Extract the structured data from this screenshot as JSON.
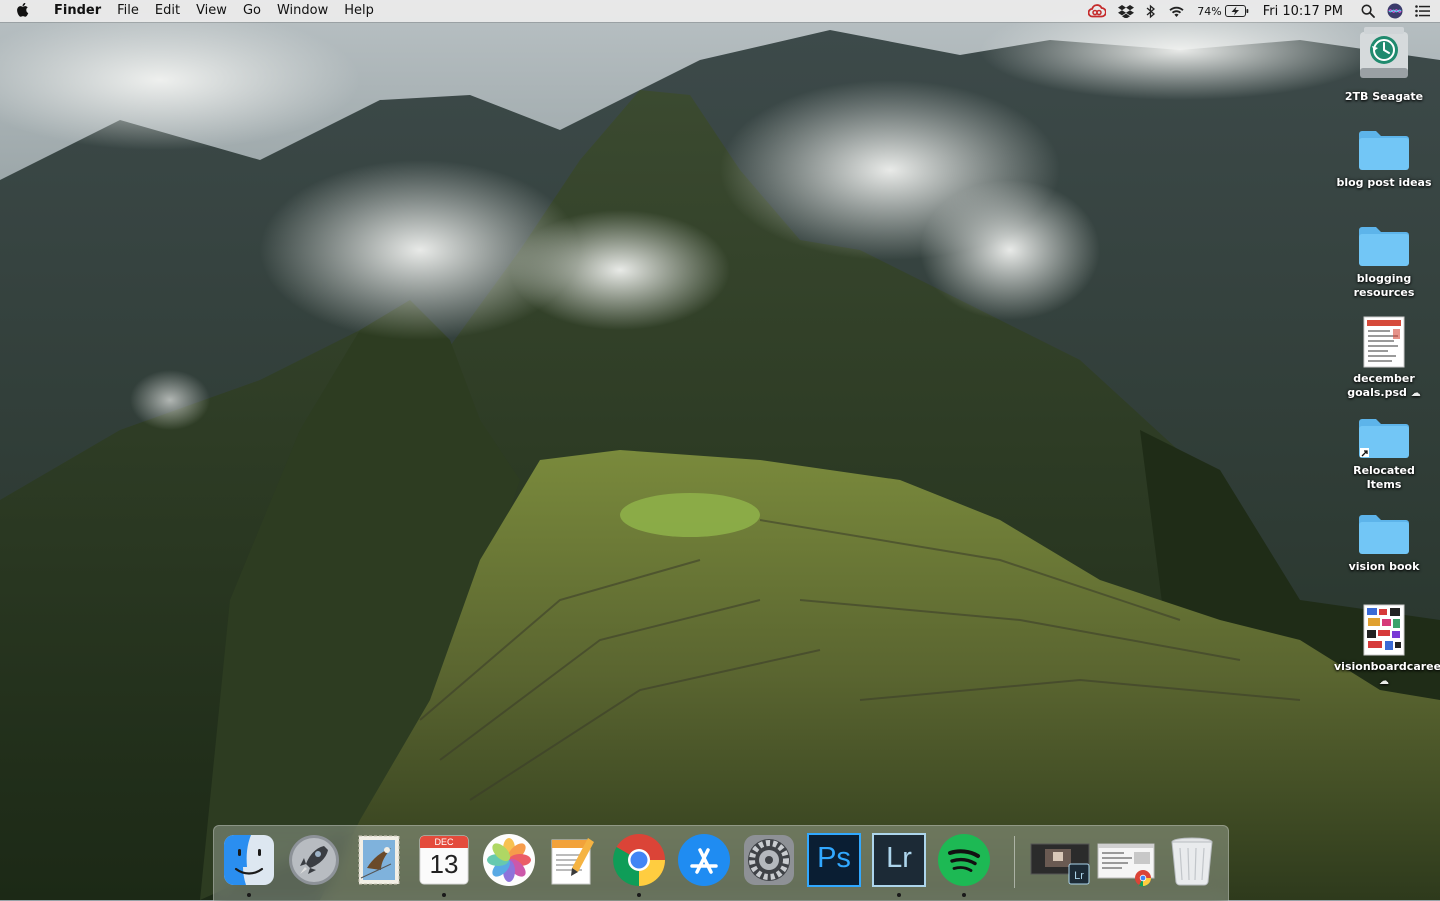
{
  "menubar": {
    "app_name": "Finder",
    "menus": [
      "File",
      "Edit",
      "View",
      "Go",
      "Window",
      "Help"
    ],
    "battery_percent": "74%",
    "clock": "Fri 10:17 PM"
  },
  "desktop": {
    "items": [
      {
        "label": "2TB Seagate",
        "kind": "time-machine-drive"
      },
      {
        "label": "blog post ideas",
        "kind": "folder"
      },
      {
        "label": "blogging resources",
        "kind": "folder"
      },
      {
        "label": "december goals.psd",
        "kind": "document",
        "cloud": "☁"
      },
      {
        "label": "Relocated Items",
        "kind": "folder-alias"
      },
      {
        "label": "vision book",
        "kind": "folder"
      },
      {
        "label": "visionboardcareer.psd",
        "kind": "document",
        "cloud": "☁"
      }
    ]
  },
  "dock": {
    "calendar_month": "DEC",
    "calendar_day": "13",
    "photoshop_label": "Ps",
    "lightroom_label": "Lr",
    "apps": [
      {
        "name": "Finder",
        "running": true
      },
      {
        "name": "Launchpad",
        "running": false
      },
      {
        "name": "Mail",
        "running": false
      },
      {
        "name": "Calendar",
        "running": true
      },
      {
        "name": "Photos",
        "running": false
      },
      {
        "name": "Pages",
        "running": false
      },
      {
        "name": "Google Chrome",
        "running": true
      },
      {
        "name": "App Store",
        "running": false
      },
      {
        "name": "System Preferences",
        "running": false
      },
      {
        "name": "Photoshop",
        "running": false
      },
      {
        "name": "Lightroom",
        "running": true
      },
      {
        "name": "Spotify",
        "running": true
      }
    ]
  },
  "colors": {
    "folder": "#6ec3f4",
    "spotify": "#1db954",
    "photoshop": "#31a8ff",
    "lightroom": "#add5ec"
  }
}
